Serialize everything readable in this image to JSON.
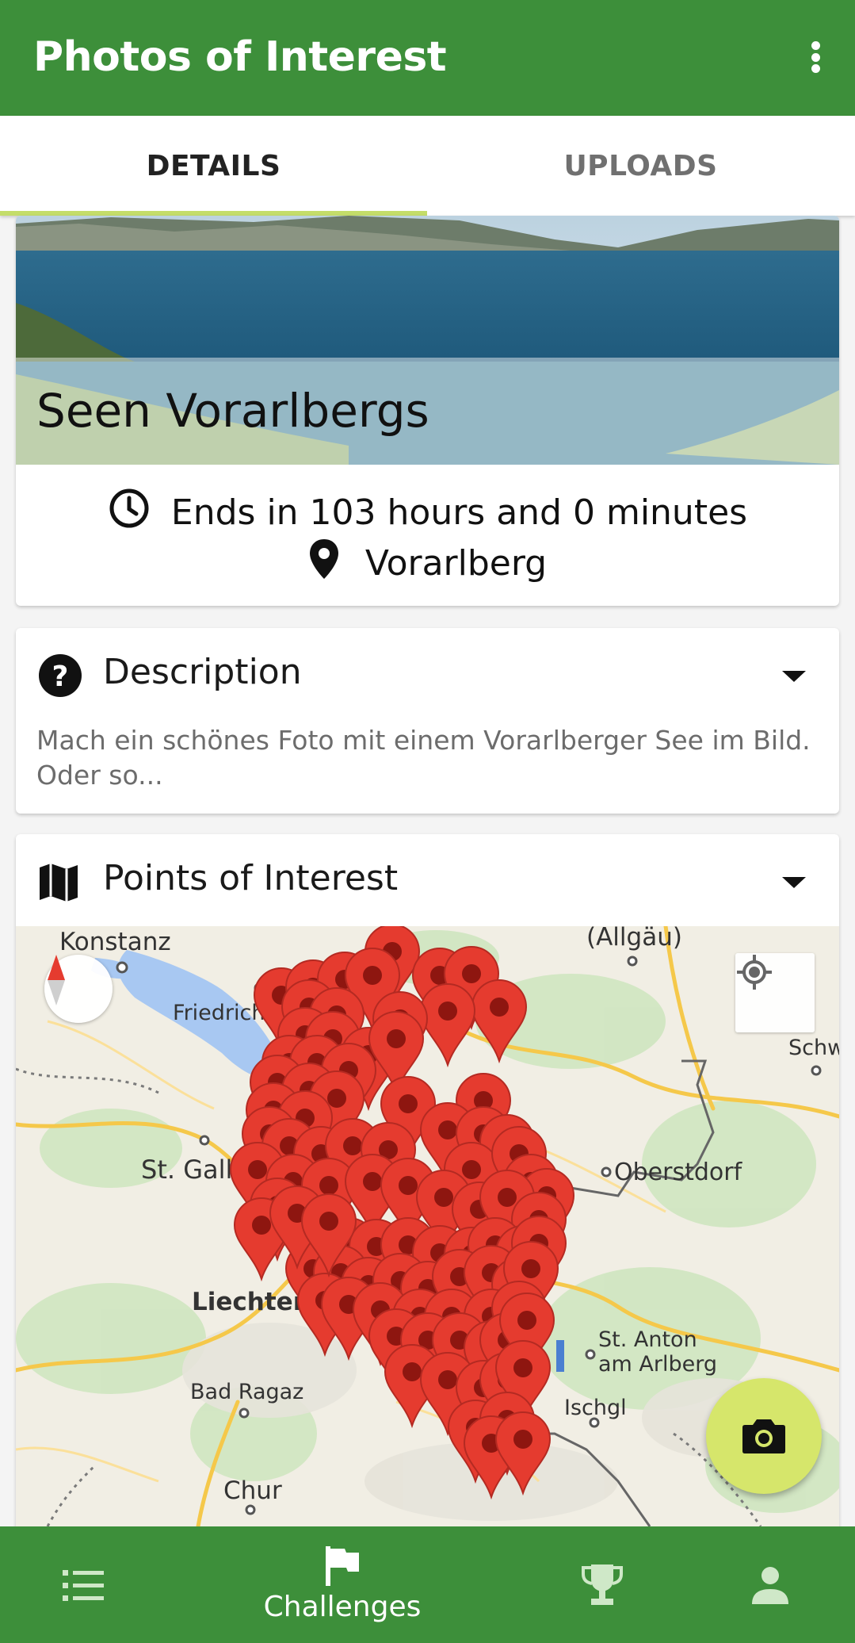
{
  "app": {
    "title": "Photos of Interest"
  },
  "icons": {
    "overflow_menu": "more-vert-icon",
    "clock": "clock-icon",
    "location": "location-pin-icon",
    "help": "help-circle-icon",
    "map": "map-icon",
    "camera": "camera-icon"
  },
  "tabs": [
    {
      "label": "DETAILS",
      "active": true
    },
    {
      "label": "UPLOADS",
      "active": false
    }
  ],
  "challenge": {
    "title": "Seen Vorarlbergs",
    "ends_text": "Ends in 103 hours and 0 minutes",
    "location": "Vorarlberg"
  },
  "description": {
    "heading": "Description",
    "text": "Mach ein schönes Foto mit einem Vorarlberger See im Bild. Oder so..."
  },
  "poi": {
    "heading": "Points of Interest",
    "map_labels": [
      "Konstanz",
      "(Allgäu)",
      "Friedrichshafen",
      "Schwang",
      "St. Gallen",
      "Oberstdorf",
      "Liechtenstein",
      "St. Anton",
      "am Arlberg",
      "Bad Ragaz",
      "Ischgl",
      "Chur"
    ]
  },
  "bottom_nav": [
    {
      "icon": "list-icon",
      "label": "",
      "active": false
    },
    {
      "icon": "flag-icon",
      "label": "Challenges",
      "active": true
    },
    {
      "icon": "trophy-icon",
      "label": "",
      "active": false
    },
    {
      "icon": "person-icon",
      "label": "",
      "active": false
    }
  ],
  "colors": {
    "primary": "#3d8f3a",
    "accent": "#d6e66b",
    "tab_indicator": "#c4dd6a",
    "marker": "#e53b2f"
  }
}
